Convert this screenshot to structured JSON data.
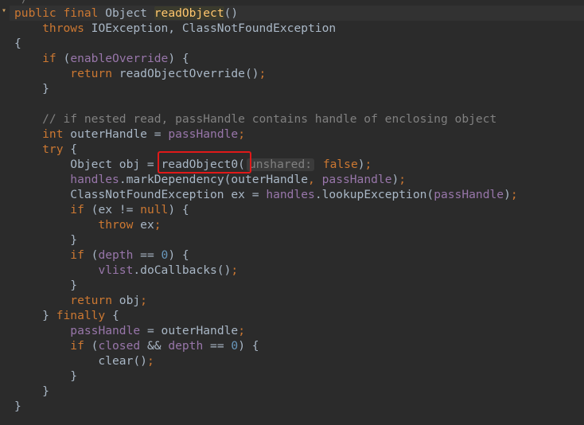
{
  "editor": {
    "lines": [
      {
        "tokens": [
          {
            "t": "public final ",
            "c": "kw"
          },
          {
            "t": "Object ",
            "c": "plain"
          },
          {
            "t": "readObject",
            "c": "fn"
          },
          {
            "t": "()",
            "c": "plain"
          }
        ]
      },
      {
        "tokens": [
          {
            "t": "    throws ",
            "c": "kw"
          },
          {
            "t": "IOException, ClassNotFoundException",
            "c": "plain"
          }
        ]
      },
      {
        "tokens": [
          {
            "t": "{",
            "c": "plain"
          }
        ]
      },
      {
        "tokens": [
          {
            "t": "    if ",
            "c": "kw"
          },
          {
            "t": "(",
            "c": "plain"
          },
          {
            "t": "enableOverride",
            "c": "field"
          },
          {
            "t": ") {",
            "c": "plain"
          }
        ]
      },
      {
        "tokens": [
          {
            "t": "        return ",
            "c": "kw"
          },
          {
            "t": "readObjectOverride()",
            "c": "plain"
          },
          {
            "t": ";",
            "c": "kw"
          }
        ]
      },
      {
        "tokens": [
          {
            "t": "    }",
            "c": "plain"
          }
        ]
      },
      {
        "tokens": []
      },
      {
        "tokens": [
          {
            "t": "    // if nested read, passHandle contains handle of enclosing object",
            "c": "cmt"
          }
        ]
      },
      {
        "tokens": [
          {
            "t": "    int ",
            "c": "kw"
          },
          {
            "t": "outerHandle = ",
            "c": "plain"
          },
          {
            "t": "passHandle",
            "c": "field"
          },
          {
            "t": ";",
            "c": "kw"
          }
        ]
      },
      {
        "tokens": [
          {
            "t": "    try ",
            "c": "kw"
          },
          {
            "t": "{",
            "c": "plain"
          }
        ]
      },
      {
        "tokens": [
          {
            "t": "        Object obj = ",
            "c": "plain"
          },
          {
            "t": "readObject0(",
            "c": "plain"
          },
          {
            "hint": "unshared:"
          },
          {
            "t": " false",
            "c": "kw"
          },
          {
            "t": ")",
            "c": "plain"
          },
          {
            "t": ";",
            "c": "kw"
          }
        ]
      },
      {
        "tokens": [
          {
            "t": "        ",
            "c": "plain"
          },
          {
            "t": "handles",
            "c": "field"
          },
          {
            "t": ".markDependency(outerHandle",
            "c": "plain"
          },
          {
            "t": ", ",
            "c": "kw"
          },
          {
            "t": "passHandle",
            "c": "field"
          },
          {
            "t": ")",
            "c": "plain"
          },
          {
            "t": ";",
            "c": "kw"
          }
        ]
      },
      {
        "tokens": [
          {
            "t": "        ClassNotFoundException ex = ",
            "c": "plain"
          },
          {
            "t": "handles",
            "c": "field"
          },
          {
            "t": ".lookupException(",
            "c": "plain"
          },
          {
            "t": "passHandle",
            "c": "field"
          },
          {
            "t": ")",
            "c": "plain"
          },
          {
            "t": ";",
            "c": "kw"
          }
        ]
      },
      {
        "tokens": [
          {
            "t": "        if ",
            "c": "kw"
          },
          {
            "t": "(ex != ",
            "c": "plain"
          },
          {
            "t": "null",
            "c": "kw"
          },
          {
            "t": ") {",
            "c": "plain"
          }
        ]
      },
      {
        "tokens": [
          {
            "t": "            throw ",
            "c": "kw"
          },
          {
            "t": "ex",
            "c": "plain"
          },
          {
            "t": ";",
            "c": "kw"
          }
        ]
      },
      {
        "tokens": [
          {
            "t": "        }",
            "c": "plain"
          }
        ]
      },
      {
        "tokens": [
          {
            "t": "        if ",
            "c": "kw"
          },
          {
            "t": "(",
            "c": "plain"
          },
          {
            "t": "depth",
            "c": "field"
          },
          {
            "t": " == ",
            "c": "plain"
          },
          {
            "t": "0",
            "c": "num"
          },
          {
            "t": ") {",
            "c": "plain"
          }
        ]
      },
      {
        "tokens": [
          {
            "t": "            ",
            "c": "plain"
          },
          {
            "t": "vlist",
            "c": "field"
          },
          {
            "t": ".doCallbacks()",
            "c": "plain"
          },
          {
            "t": ";",
            "c": "kw"
          }
        ]
      },
      {
        "tokens": [
          {
            "t": "        }",
            "c": "plain"
          }
        ]
      },
      {
        "tokens": [
          {
            "t": "        return ",
            "c": "kw"
          },
          {
            "t": "obj",
            "c": "plain"
          },
          {
            "t": ";",
            "c": "kw"
          }
        ]
      },
      {
        "tokens": [
          {
            "t": "    } ",
            "c": "plain"
          },
          {
            "t": "finally ",
            "c": "kw"
          },
          {
            "t": "{",
            "c": "plain"
          }
        ]
      },
      {
        "tokens": [
          {
            "t": "        ",
            "c": "plain"
          },
          {
            "t": "passHandle",
            "c": "field"
          },
          {
            "t": " = outerHandle",
            "c": "plain"
          },
          {
            "t": ";",
            "c": "kw"
          }
        ]
      },
      {
        "tokens": [
          {
            "t": "        if ",
            "c": "kw"
          },
          {
            "t": "(",
            "c": "plain"
          },
          {
            "t": "closed",
            "c": "field"
          },
          {
            "t": " && ",
            "c": "plain"
          },
          {
            "t": "depth",
            "c": "field"
          },
          {
            "t": " == ",
            "c": "plain"
          },
          {
            "t": "0",
            "c": "num"
          },
          {
            "t": ") {",
            "c": "plain"
          }
        ]
      },
      {
        "tokens": [
          {
            "t": "            clear()",
            "c": "plain"
          },
          {
            "t": ";",
            "c": "kw"
          }
        ]
      },
      {
        "tokens": [
          {
            "t": "        }",
            "c": "plain"
          }
        ]
      },
      {
        "tokens": [
          {
            "t": "    }",
            "c": "plain"
          }
        ]
      },
      {
        "tokens": [
          {
            "t": "}",
            "c": "plain"
          }
        ]
      }
    ]
  },
  "colors": {
    "background": "#2b2b2b",
    "keyword": "#cc7832",
    "method_decl": "#ffc66d",
    "field": "#9876aa",
    "number": "#6897bb",
    "comment": "#808080",
    "text": "#a9b7c6",
    "annotation_box": "#e01919"
  },
  "icons": {
    "fold_marker": "fold-arrow-icon"
  }
}
